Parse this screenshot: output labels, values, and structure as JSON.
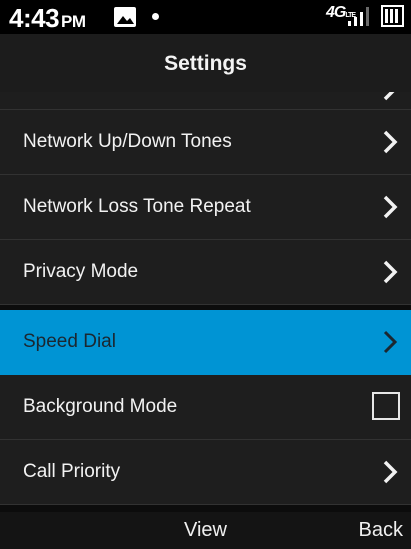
{
  "status": {
    "time": "4:43",
    "ampm": "PM",
    "network": "4G",
    "network_sub": "LTE"
  },
  "title": "Settings",
  "list": {
    "items": [
      {
        "label": "Network Up/Down Tones",
        "control": "chevron"
      },
      {
        "label": "Network Loss Tone Repeat",
        "control": "chevron"
      },
      {
        "label": "Privacy Mode",
        "control": "chevron"
      },
      {
        "label": "Speed Dial",
        "control": "chevron",
        "selected": true
      },
      {
        "label": "Background Mode",
        "control": "checkbox",
        "checked": false
      },
      {
        "label": "Call Priority",
        "control": "chevron"
      }
    ]
  },
  "softkeys": {
    "center": "View",
    "right": "Back"
  },
  "colors": {
    "selection": "#0094d4",
    "row_background": "#1e1e1e",
    "title_background": "#1c1c1c"
  }
}
